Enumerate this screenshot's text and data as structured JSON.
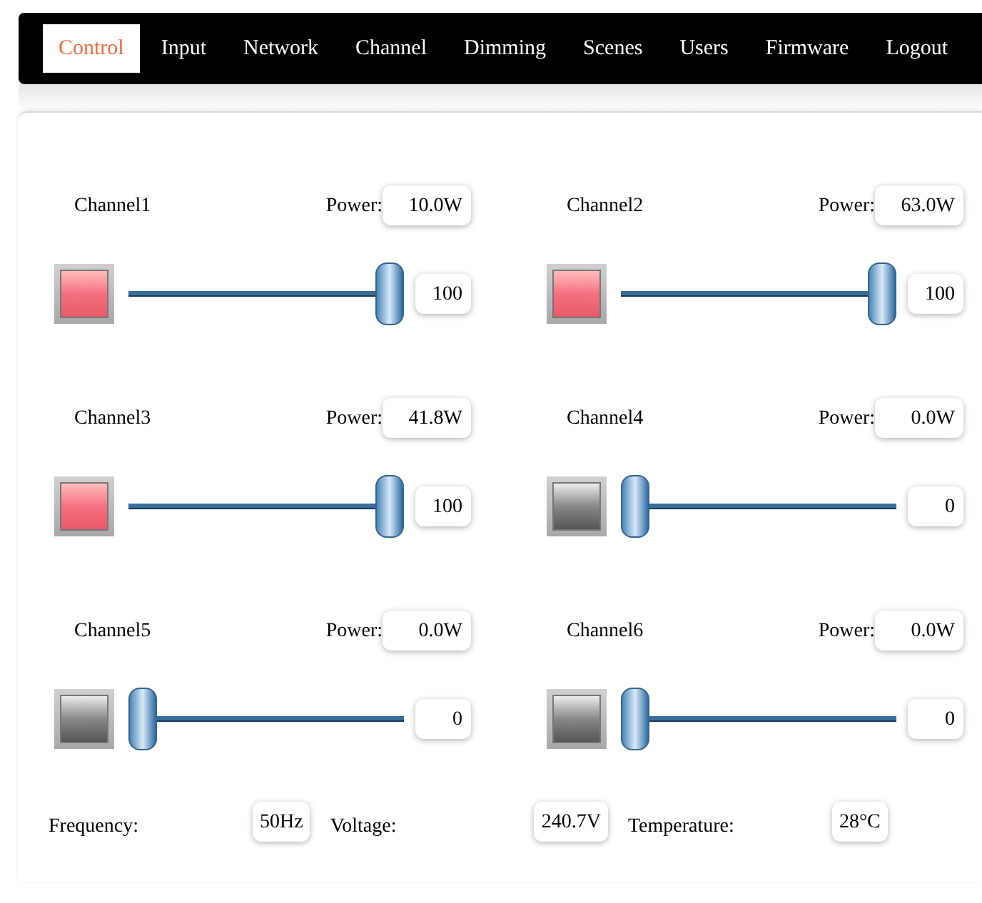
{
  "nav": [
    {
      "label": "Control",
      "selected": true
    },
    {
      "label": "Input",
      "selected": false
    },
    {
      "label": "Network",
      "selected": false
    },
    {
      "label": "Channel",
      "selected": false
    },
    {
      "label": "Dimming",
      "selected": false
    },
    {
      "label": "Scenes",
      "selected": false
    },
    {
      "label": "Users",
      "selected": false
    },
    {
      "label": "Firmware",
      "selected": false
    },
    {
      "label": "Logout",
      "selected": false
    }
  ],
  "channels": [
    {
      "name": "Channel1",
      "power_label": "Power:",
      "power": "10.0W",
      "on": true,
      "level": 1,
      "value": "100"
    },
    {
      "name": "Channel2",
      "power_label": "Power:",
      "power": "63.0W",
      "on": true,
      "level": 1,
      "value": "100"
    },
    {
      "name": "Channel3",
      "power_label": "Power:",
      "power": "41.8W",
      "on": true,
      "level": 1,
      "value": "100"
    },
    {
      "name": "Channel4",
      "power_label": "Power:",
      "power": "0.0W",
      "on": false,
      "level": 0,
      "value": "0"
    },
    {
      "name": "Channel5",
      "power_label": "Power:",
      "power": "0.0W",
      "on": false,
      "level": 0,
      "value": "0"
    },
    {
      "name": "Channel6",
      "power_label": "Power:",
      "power": "0.0W",
      "on": false,
      "level": 0,
      "value": "0"
    }
  ],
  "status": [
    {
      "label": "Frequency:",
      "value": "50Hz"
    },
    {
      "label": "Voltage:",
      "value": "240.7V"
    },
    {
      "label": "Temperature:",
      "value": "28°C"
    }
  ]
}
